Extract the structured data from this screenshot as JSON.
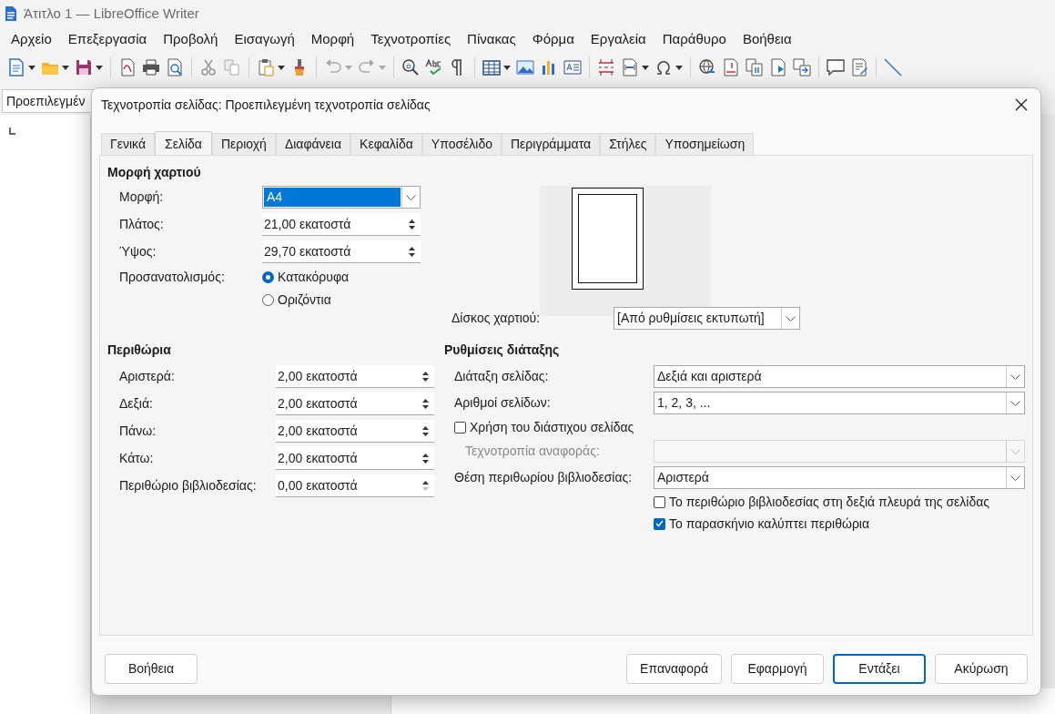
{
  "window": {
    "title": "Άτιτλο 1 — LibreOffice Writer"
  },
  "menu": [
    "Αρχείο",
    "Επεξεργασία",
    "Προβολή",
    "Εισαγωγή",
    "Μορφή",
    "Τεχνοτροπίες",
    "Πίνακας",
    "Φόρμα",
    "Εργαλεία",
    "Παράθυρο",
    "Βοήθεια"
  ],
  "style_box": {
    "value": "Προεπιλεγμέν"
  },
  "dialog": {
    "title": "Τεχνοτροπία σελίδας: Προεπιλεγμένη τεχνοτροπία σελίδας",
    "tabs": [
      {
        "label": "Γενικά",
        "selected": false
      },
      {
        "label": "Σελίδα",
        "selected": true
      },
      {
        "label": "Περιοχή",
        "selected": false
      },
      {
        "label": "Διαφάνεια",
        "selected": false
      },
      {
        "label": "Κεφαλίδα",
        "selected": false
      },
      {
        "label": "Υποσέλιδο",
        "selected": false
      },
      {
        "label": "Περιγράμματα",
        "selected": false
      },
      {
        "label": "Στήλες",
        "selected": false
      },
      {
        "label": "Υποσημείωση",
        "selected": false
      }
    ],
    "paper_format": {
      "heading": "Μορφή χαρτιού",
      "format": {
        "label": "Μορφή:",
        "value": "A4"
      },
      "fields": [
        {
          "label": "Πλάτος:",
          "value": "21,00 εκατοστά",
          "decrease_disabled": false
        },
        {
          "label": "Ύψος:",
          "value": "29,70 εκατοστά",
          "decrease_disabled": false
        }
      ],
      "orientation": {
        "label": "Προσανατολισμός:",
        "options": [
          {
            "label": "Κατακόρυφα",
            "selected": true
          },
          {
            "label": "Οριζόντια",
            "selected": false
          }
        ]
      },
      "paper_tray": {
        "label": "Δίσκος χαρτιού:",
        "value": "[Από ρυθμίσεις εκτυπωτή]"
      }
    },
    "margins": {
      "heading": "Περιθώρια",
      "fields": [
        {
          "label": "Αριστερά:",
          "value": "2,00 εκατοστά",
          "decrease_disabled": false
        },
        {
          "label": "Δεξιά:",
          "value": "2,00 εκατοστά",
          "decrease_disabled": false
        },
        {
          "label": "Πάνω:",
          "value": "2,00 εκατοστά",
          "decrease_disabled": false
        },
        {
          "label": "Κάτω:",
          "value": "2,00 εκατοστά",
          "decrease_disabled": false
        },
        {
          "label": "Περιθώριο βιβλιοδεσίας:",
          "value": "0,00 εκατοστά",
          "decrease_disabled": true
        }
      ]
    },
    "layout": {
      "heading": "Ρυθμίσεις διάταξης",
      "rows": [
        {
          "kind": "dropdown",
          "label": "Διάταξη σελίδας:",
          "value": "Δεξιά και αριστερά",
          "disabled": false
        },
        {
          "kind": "dropdown",
          "label": "Αριθμοί σελίδων:",
          "value": "1, 2, 3, ...",
          "disabled": false
        },
        {
          "kind": "checkbox",
          "label": "Χρήση του διάστιχου σελίδας",
          "checked": false
        },
        {
          "kind": "dropdown",
          "label": "Τεχνοτροπία αναφοράς:",
          "disabled": true
        },
        {
          "kind": "dropdown",
          "label": "Θέση περιθωρίου βιβλιοδεσίας:",
          "value": "Αριστερά",
          "disabled": false
        },
        {
          "kind": "checkbox",
          "label": "Το περιθώριο βιβλιοδεσίας στη δεξιά πλευρά της σελίδας",
          "checked": false
        },
        {
          "kind": "checkbox",
          "label": "Το παρασκήνιο καλύπτει περιθώρια",
          "checked": true
        }
      ]
    },
    "buttons": [
      {
        "label": "Βοήθεια",
        "default": false
      },
      {
        "label": "Επαναφορά",
        "default": false
      },
      {
        "label": "Εφαρμογή",
        "default": false
      },
      {
        "label": "Εντάξει",
        "default": true
      },
      {
        "label": "Ακύρωση",
        "default": false
      }
    ]
  }
}
